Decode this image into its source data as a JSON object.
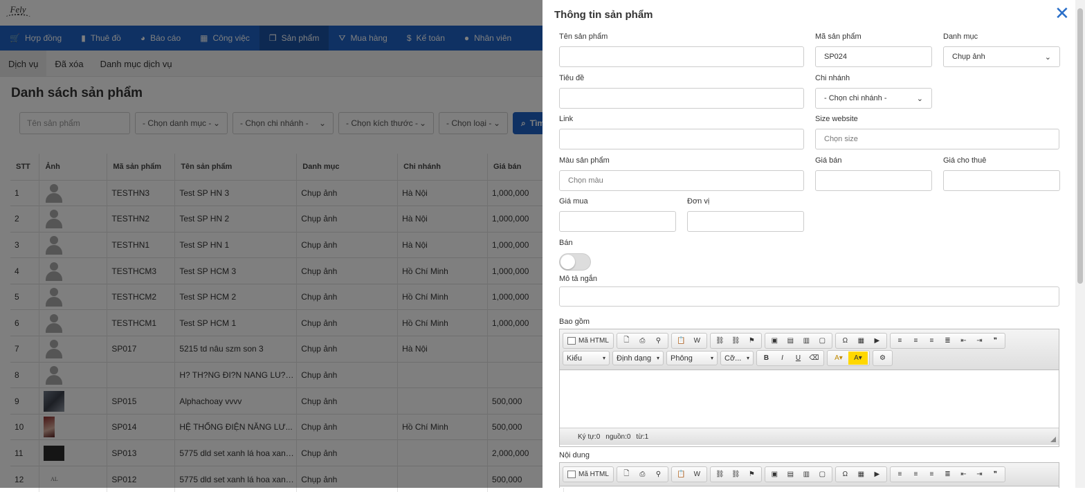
{
  "app": {
    "logo_text": "Fely"
  },
  "nav": {
    "items": [
      {
        "icon": "cart-icon",
        "glyph": "🛒",
        "label": "Hợp đồng"
      },
      {
        "icon": "book-icon",
        "glyph": "▮",
        "label": "Thuê đồ"
      },
      {
        "icon": "chart-pie-icon",
        "glyph": "◕",
        "label": "Báo cáo"
      },
      {
        "icon": "calendar-icon",
        "glyph": "▦",
        "label": "Công việc"
      },
      {
        "icon": "cube-icon",
        "glyph": "❒",
        "label": "Sản phẩm"
      },
      {
        "icon": "basket-icon",
        "glyph": "⛛",
        "label": "Mua hàng"
      },
      {
        "icon": "dollar-icon",
        "glyph": "$",
        "label": "Kế toán"
      },
      {
        "icon": "user-icon",
        "glyph": "●",
        "label": "Nhân viên"
      }
    ],
    "active_index": 4
  },
  "subtabs": [
    "Dịch vụ",
    "Đã xóa",
    "Danh mục dịch vụ"
  ],
  "page": {
    "title": "Danh sách sản phẩm"
  },
  "filters": {
    "name_placeholder": "Tên sản phẩm",
    "category": "- Chọn danh mục -",
    "branch": "- Chọn chi nhánh -",
    "size": "- Chọn kích thước -",
    "type": "- Chọn loại -",
    "search_label": "Tìm"
  },
  "table": {
    "headers": [
      "STT",
      "Ảnh",
      "Mã sản phẩm",
      "Tên sản phẩm",
      "Danh mục",
      "Chi nhánh",
      "Giá bán"
    ],
    "rows": [
      {
        "stt": "1",
        "img": "avatar",
        "code": "TESTHN3",
        "name": "Test SP HN 3",
        "cat": "Chụp ảnh",
        "branch": "Hà Nội",
        "price": "1,000,000"
      },
      {
        "stt": "2",
        "img": "avatar",
        "code": "TESTHN2",
        "name": "Test SP HN 2",
        "cat": "Chụp ảnh",
        "branch": "Hà Nội",
        "price": "1,000,000"
      },
      {
        "stt": "3",
        "img": "avatar",
        "code": "TESTHN1",
        "name": "Test SP HN 1",
        "cat": "Chụp ảnh",
        "branch": "Hà Nội",
        "price": "1,000,000"
      },
      {
        "stt": "4",
        "img": "avatar",
        "code": "TESTHCM3",
        "name": "Test SP HCM 3",
        "cat": "Chụp ảnh",
        "branch": "Hồ Chí Minh",
        "price": "1,000,000"
      },
      {
        "stt": "5",
        "img": "avatar",
        "code": "TESTHCM2",
        "name": "Test SP HCM 2",
        "cat": "Chụp ảnh",
        "branch": "Hồ Chí Minh",
        "price": "1,000,000"
      },
      {
        "stt": "6",
        "img": "avatar",
        "code": "TESTHCM1",
        "name": "Test SP HCM 1",
        "cat": "Chụp ảnh",
        "branch": "Hồ Chí Minh",
        "price": "1,000,000"
      },
      {
        "stt": "7",
        "img": "avatar",
        "code": "SP017",
        "name": "5215 td nâu szm son 3",
        "cat": "Chụp ảnh",
        "branch": "Hà Nội",
        "price": ""
      },
      {
        "stt": "8",
        "img": "avatar",
        "code": "",
        "name": "H? TH?NG ĐI?N NANG LU?N...",
        "cat": "Chụp ảnh",
        "branch": "",
        "price": ""
      },
      {
        "stt": "9",
        "img": "photo",
        "code": "SP015",
        "name": "Alphachoay vvvv",
        "cat": "Chụp ảnh",
        "branch": "",
        "price": "500,000"
      },
      {
        "stt": "10",
        "img": "photo2",
        "code": "SP014",
        "name": "HỆ THỐNG ĐIỆN NĂNG LƯ...",
        "cat": "Chụp ảnh",
        "branch": "Hồ Chí Minh",
        "price": "500,000"
      },
      {
        "stt": "11",
        "img": "photo3",
        "code": "SP013",
        "name": "5775 dld set xanh lá hoa xanh...",
        "cat": "Chụp ảnh",
        "branch": "",
        "price": "2,000,000"
      },
      {
        "stt": "12",
        "img": "logo2",
        "code": "SP012",
        "name": "5775 dld set xanh lá hoa xanh...",
        "cat": "Chụp ảnh",
        "branch": "",
        "price": "500,000"
      }
    ]
  },
  "panel": {
    "title": "Thông tin sản phẩm",
    "close_glyph": "✕",
    "fields": {
      "product_name": {
        "label": "Tên sản phẩm",
        "value": ""
      },
      "product_code": {
        "label": "Mã sản phẩm",
        "value": "SP024"
      },
      "category": {
        "label": "Danh mục",
        "value": "Chụp ảnh"
      },
      "title": {
        "label": "Tiêu đề",
        "value": ""
      },
      "branch": {
        "label": "Chi nhánh",
        "value": "- Chọn chi nhánh -"
      },
      "link": {
        "label": "Link",
        "value": ""
      },
      "size_website": {
        "label": "Size website",
        "placeholder": "Chọn size"
      },
      "color": {
        "label": "Màu sản phẩm",
        "placeholder": "Chọn màu"
      },
      "sale_price": {
        "label": "Giá bán",
        "value": ""
      },
      "rent_price": {
        "label": "Giá cho thuê",
        "value": ""
      },
      "buy_price": {
        "label": "Giá mua",
        "value": ""
      },
      "unit": {
        "label": "Đơn vị",
        "value": ""
      },
      "sell": {
        "label": "Bán",
        "on": false
      },
      "short_desc": {
        "label": "Mô tả ngắn",
        "value": ""
      },
      "includes": {
        "label": "Bao gồm"
      },
      "content": {
        "label": "Nội dung"
      }
    },
    "editor": {
      "source_label": "Mã HTML",
      "style_combo": "Kiểu",
      "format_combo": "Định dạng",
      "font_combo": "Phông",
      "size_combo": "Cỡ...",
      "bold": "B",
      "italic": "I",
      "underline": "U",
      "footer": {
        "chars": "Ký tự:0",
        "source": "nguồn:0",
        "words": "từ:1"
      }
    }
  },
  "colors": {
    "nav": "#1f63c6",
    "nav_active": "#1a52a5",
    "close": "#2a6fc9"
  }
}
